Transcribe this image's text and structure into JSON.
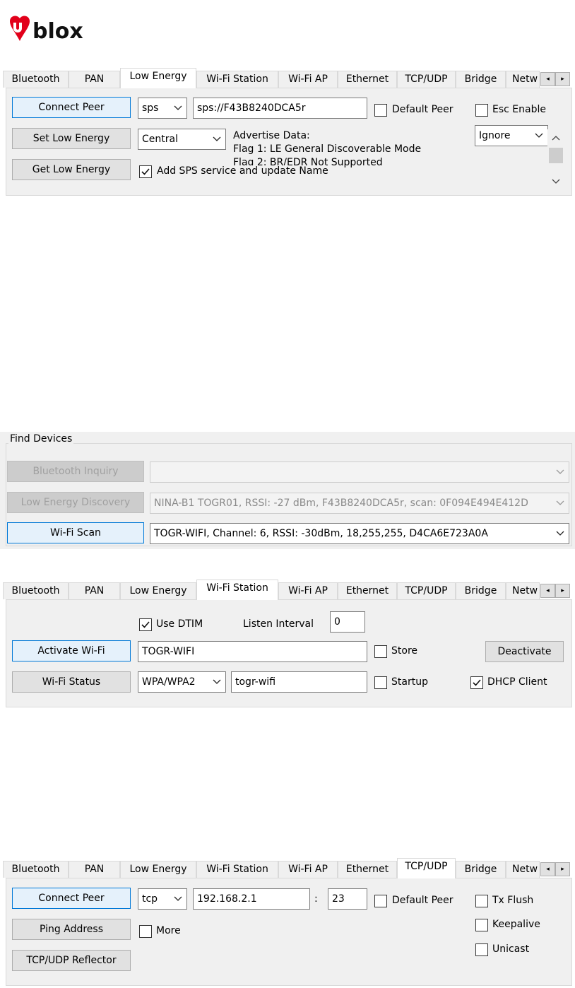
{
  "logo": {
    "text": "ublox",
    "brand_color": "#e2001a"
  },
  "tabs": [
    "Bluetooth",
    "PAN",
    "Low Energy",
    "Wi-Fi Station",
    "Wi-Fi AP",
    "Ethernet",
    "TCP/UDP",
    "Bridge",
    "Netw"
  ],
  "scroll_left_icon": "◂",
  "scroll_right_icon": "▸",
  "low_energy": {
    "active_tab": "Low Energy",
    "connect_peer": "Connect Peer",
    "set_low_energy": "Set Low Energy",
    "get_low_energy": "Get Low Energy",
    "protocol": "sps",
    "peer_url": "sps://F43B8240DCA5r",
    "default_peer": "Default Peer",
    "esc_enable": "Esc Enable",
    "role": "Central",
    "advertise_title": "Advertise Data:",
    "advertise_line1": "Flag 1: LE General Discoverable Mode",
    "advertise_line2": "Flag 2: BR/EDR Not Supported",
    "esc_mode": "Ignore",
    "add_sps": "Add SPS service and update Name",
    "add_sps_checked": true
  },
  "find_devices": {
    "title": "Find Devices",
    "bt_inquiry": "Bluetooth Inquiry",
    "bt_inquiry_value": "",
    "le_discovery": "Low Energy Discovery",
    "le_discovery_value": "NINA-B1 TOGR01, RSSI: -27 dBm, F43B8240DCA5r, scan: 0F094E494E412D",
    "wifi_scan": "Wi-Fi Scan",
    "wifi_scan_value": "TOGR-WIFI, Channel: 6, RSSI: -30dBm, 18,255,255, D4CA6E723A0A"
  },
  "wifi_station": {
    "active_tab": "Wi-Fi Station",
    "use_dtim": "Use DTIM",
    "use_dtim_checked": true,
    "listen_interval": "Listen Interval",
    "listen_interval_value": "0",
    "activate": "Activate Wi-Fi",
    "ssid": "TOGR-WIFI",
    "store": "Store",
    "deactivate": "Deactivate",
    "status": "Wi-Fi Status",
    "security": "WPA/WPA2",
    "password": "togr-wifi",
    "startup": "Startup",
    "dhcp": "DHCP Client",
    "dhcp_checked": true
  },
  "tcp_udp": {
    "active_tab": "TCP/UDP",
    "connect_peer": "Connect Peer",
    "ping": "Ping Address",
    "reflector": "TCP/UDP Reflector",
    "protocol": "tcp",
    "address": "192.168.2.1",
    "colon": ":",
    "port": "23",
    "default_peer": "Default Peer",
    "more": "More",
    "tx_flush": "Tx Flush",
    "keepalive": "Keepalive",
    "unicast": "Unicast"
  }
}
